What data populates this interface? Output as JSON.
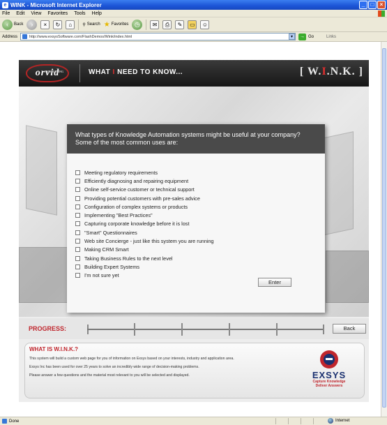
{
  "window": {
    "title": "WINK - Microsoft Internet Explorer",
    "controls": [
      "_",
      "□",
      "×"
    ]
  },
  "menu": [
    "File",
    "Edit",
    "View",
    "Favorites",
    "Tools",
    "Help"
  ],
  "toolbar": {
    "back": "Back",
    "search": "Search",
    "favorites": "Favorites"
  },
  "address": {
    "label": "Address",
    "url": "http://www.exsysSoftware.com/FlashDemos/Wink/index.html",
    "go": "Go",
    "links": "Links"
  },
  "app": {
    "logo_text": "orvid",
    "logo_small": "CONSULTING",
    "header_title_prefix": "WHAT ",
    "header_title_hl": "I",
    "header_title_suffix": " NEED TO KNOW...",
    "wink_prefix": "[ W.",
    "wink_hl": "I",
    "wink_suffix": ".N.K. ]",
    "question": "What types of Knowledge Automation systems might be useful at your company? Some of the most common uses are:",
    "options": [
      "Meeting regulatory requirements",
      "Efficiently diagnosing and repairing equipment",
      "Online self-service customer or technical support",
      "Providing potential customers with pre-sales advice",
      "Configuration of complex systems or products",
      "Implementing \"Best Practices\"",
      "Capturing corporate knowledge before it is lost",
      "\"Smart\" Questionnaires",
      "Web site Concierge - just like this system you are running",
      "Making CRM Smart",
      "Taking Business Rules to the next level",
      "Building Expert Systems",
      "I'm not sure yet"
    ],
    "enter": "Enter",
    "progress_label": "PROGRESS:",
    "back": "Back",
    "info_title": "WHAT IS W.I.N.K.?",
    "info_lines": [
      "This system will build a custom web page for you of information on Exsys based on your interests, industry and application area.",
      "Exsys Inc has been used for over 25 years to solve an incredibly wide range of decision-making problems.",
      "Please answer a few questions and the material most relevant to you will be selected and displayed."
    ],
    "exsys_word": "EXSYS",
    "exsys_tag1": "Capture Knowledge",
    "exsys_tag2": "Deliver Answers"
  },
  "status": {
    "left": "Done",
    "zone": "Internet"
  }
}
